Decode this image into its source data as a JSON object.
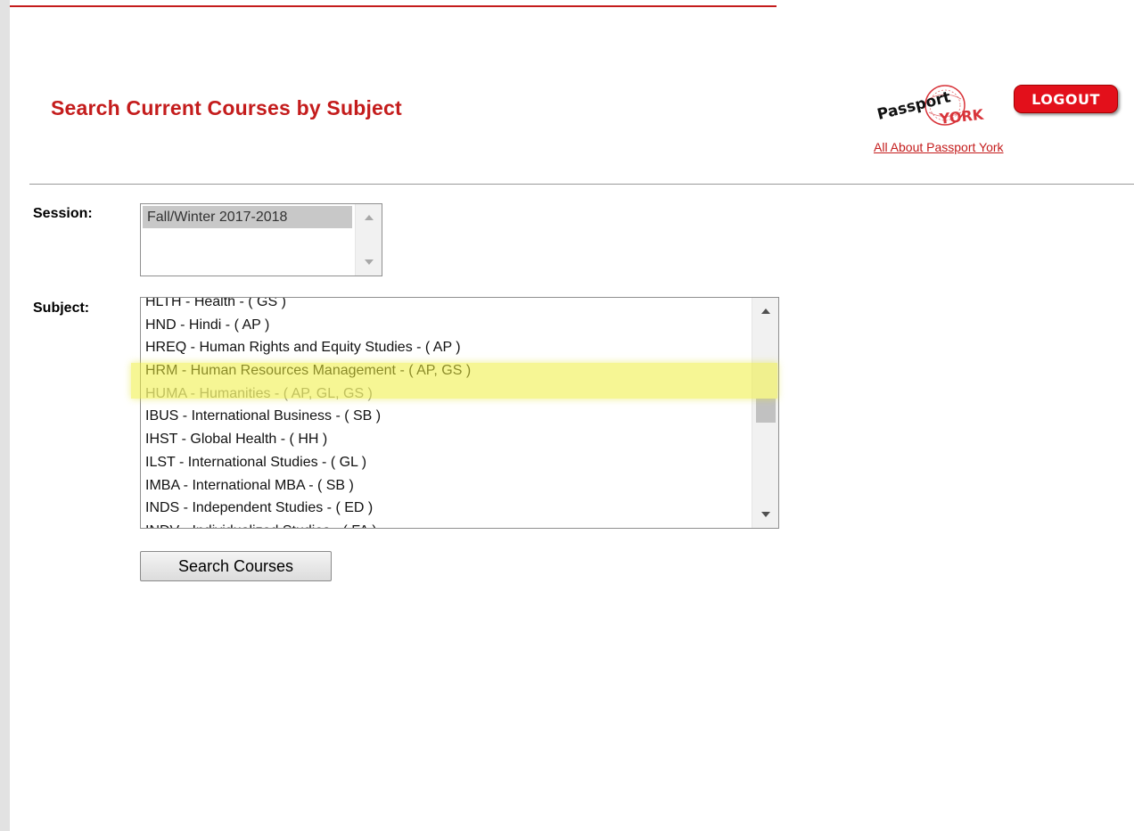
{
  "header": {
    "title": "Search Current Courses by Subject",
    "logo_text_top": "Passport",
    "logo_text_bottom": "YORK",
    "logout_label": "LOGOUT",
    "about_link": "All About Passport York"
  },
  "form": {
    "session_label": "Session:",
    "session_options": [
      "Fall/Winter 2017-2018"
    ],
    "subject_label": "Subject:",
    "subject_options": [
      "HLTH - Health - ( GS )",
      "HND - Hindi - ( AP )",
      "HREQ - Human Rights and Equity Studies - ( AP )",
      "HRM - Human Resources Management - ( AP, GS )",
      "HUMA - Humanities - ( AP, GL, GS )",
      "IBUS - International Business - ( SB )",
      "IHST - Global Health - ( HH )",
      "ILST - International Studies - ( GL )",
      "IMBA - International MBA - ( SB )",
      "INDS - Independent Studies - ( ED )",
      "INDV - Individualized Studies - ( FA )"
    ],
    "selected_subject": "HUMA - Humanities - ( AP, GL, GS )",
    "search_button_label": "Search Courses"
  },
  "colors": {
    "brand_red": "#c41c1c",
    "logout_red": "#e3101b",
    "highlight_yellow": "#eeee3c"
  }
}
